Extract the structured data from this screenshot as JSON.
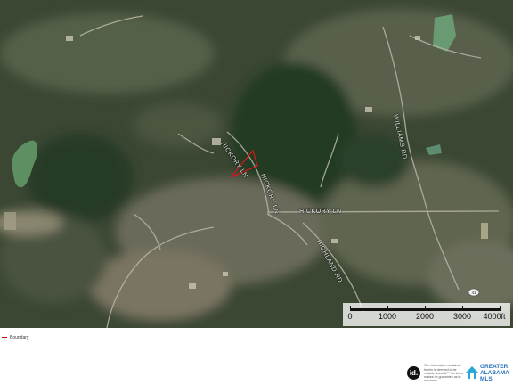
{
  "map": {
    "roads": {
      "hickory_ln_1": "HICKORY LN",
      "hickory_ln_2": "HICKORY LN",
      "hickory_ln_3": "HICKORY LN",
      "hickory_ln_4": "HICKORY LN",
      "rd_east": "WILLIAMS RD",
      "rd_south": "HIGHLAND RD"
    },
    "route_marker": "41",
    "parcel_color": "#d11a1a"
  },
  "scale": {
    "ticks": [
      "0",
      "1000",
      "2000",
      "3000",
      "4000ft"
    ]
  },
  "legend": {
    "label": "Boundary"
  },
  "footer": {
    "idx_logo": "id.",
    "disclaimer": "The information contained herein is deemed to be reliable. Land id™ Services makes no guarantee as to accuracy.",
    "brand_line1": "GREATER",
    "brand_line2": "ALABAMA",
    "brand_line3": "MLS"
  }
}
